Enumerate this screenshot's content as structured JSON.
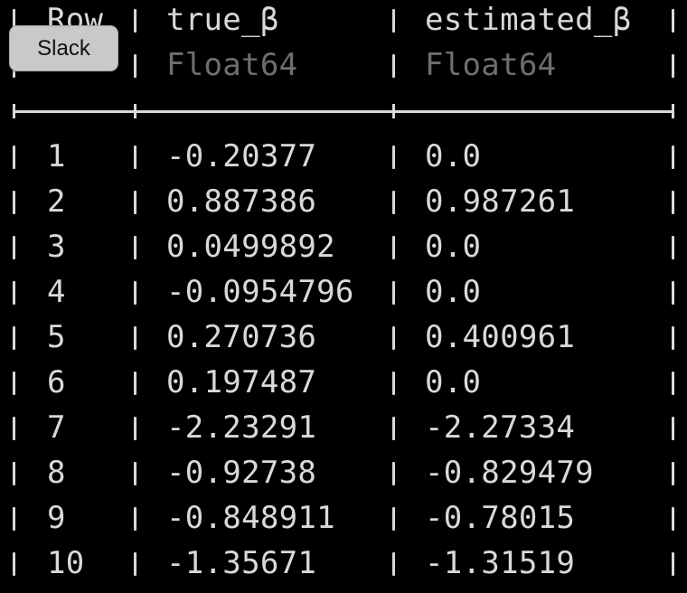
{
  "table": {
    "headers": [
      {
        "name": "Row",
        "type": ""
      },
      {
        "name": "true_β",
        "type": "Float64"
      },
      {
        "name": "estimated_β",
        "type": "Float64"
      }
    ],
    "rows": [
      {
        "row": "1",
        "true_beta": "-0.20377",
        "estimated_beta": "0.0"
      },
      {
        "row": "2",
        "true_beta": "0.887386",
        "estimated_beta": "0.987261"
      },
      {
        "row": "3",
        "true_beta": "0.0499892",
        "estimated_beta": "0.0"
      },
      {
        "row": "4",
        "true_beta": "-0.0954796",
        "estimated_beta": "0.0"
      },
      {
        "row": "5",
        "true_beta": "0.270736",
        "estimated_beta": "0.400961"
      },
      {
        "row": "6",
        "true_beta": "0.197487",
        "estimated_beta": "0.0"
      },
      {
        "row": "7",
        "true_beta": "-2.23291",
        "estimated_beta": "-2.27334"
      },
      {
        "row": "8",
        "true_beta": "-0.92738",
        "estimated_beta": "-0.829479"
      },
      {
        "row": "9",
        "true_beta": "-0.848911",
        "estimated_beta": "-0.78015"
      },
      {
        "row": "10",
        "true_beta": "-1.35671",
        "estimated_beta": "-1.31519"
      }
    ]
  },
  "overlay_button": {
    "label": "Slack"
  },
  "colors": {
    "background": "#000000",
    "text": "#d9d9d9",
    "type_label": "#6e6e6e",
    "button_bg": "#c9c9c9",
    "button_text": "#111111"
  }
}
